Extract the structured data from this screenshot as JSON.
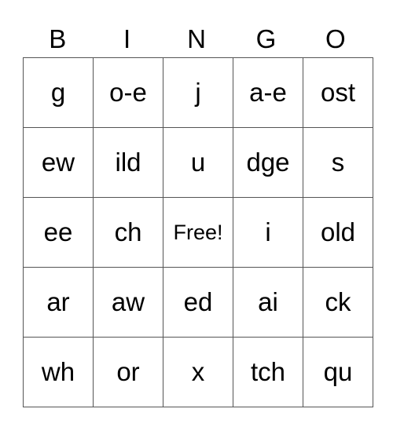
{
  "card": {
    "header": [
      "B",
      "I",
      "N",
      "G",
      "O"
    ],
    "rows": [
      [
        "g",
        "o-e",
        "j",
        "a-e",
        "ost"
      ],
      [
        "ew",
        "ild",
        "u",
        "dge",
        "s"
      ],
      [
        "ee",
        "ch",
        "Free!",
        "i",
        "old"
      ],
      [
        "ar",
        "aw",
        "ed",
        "ai",
        "ck"
      ],
      [
        "wh",
        "or",
        "x",
        "tch",
        "qu"
      ]
    ]
  }
}
